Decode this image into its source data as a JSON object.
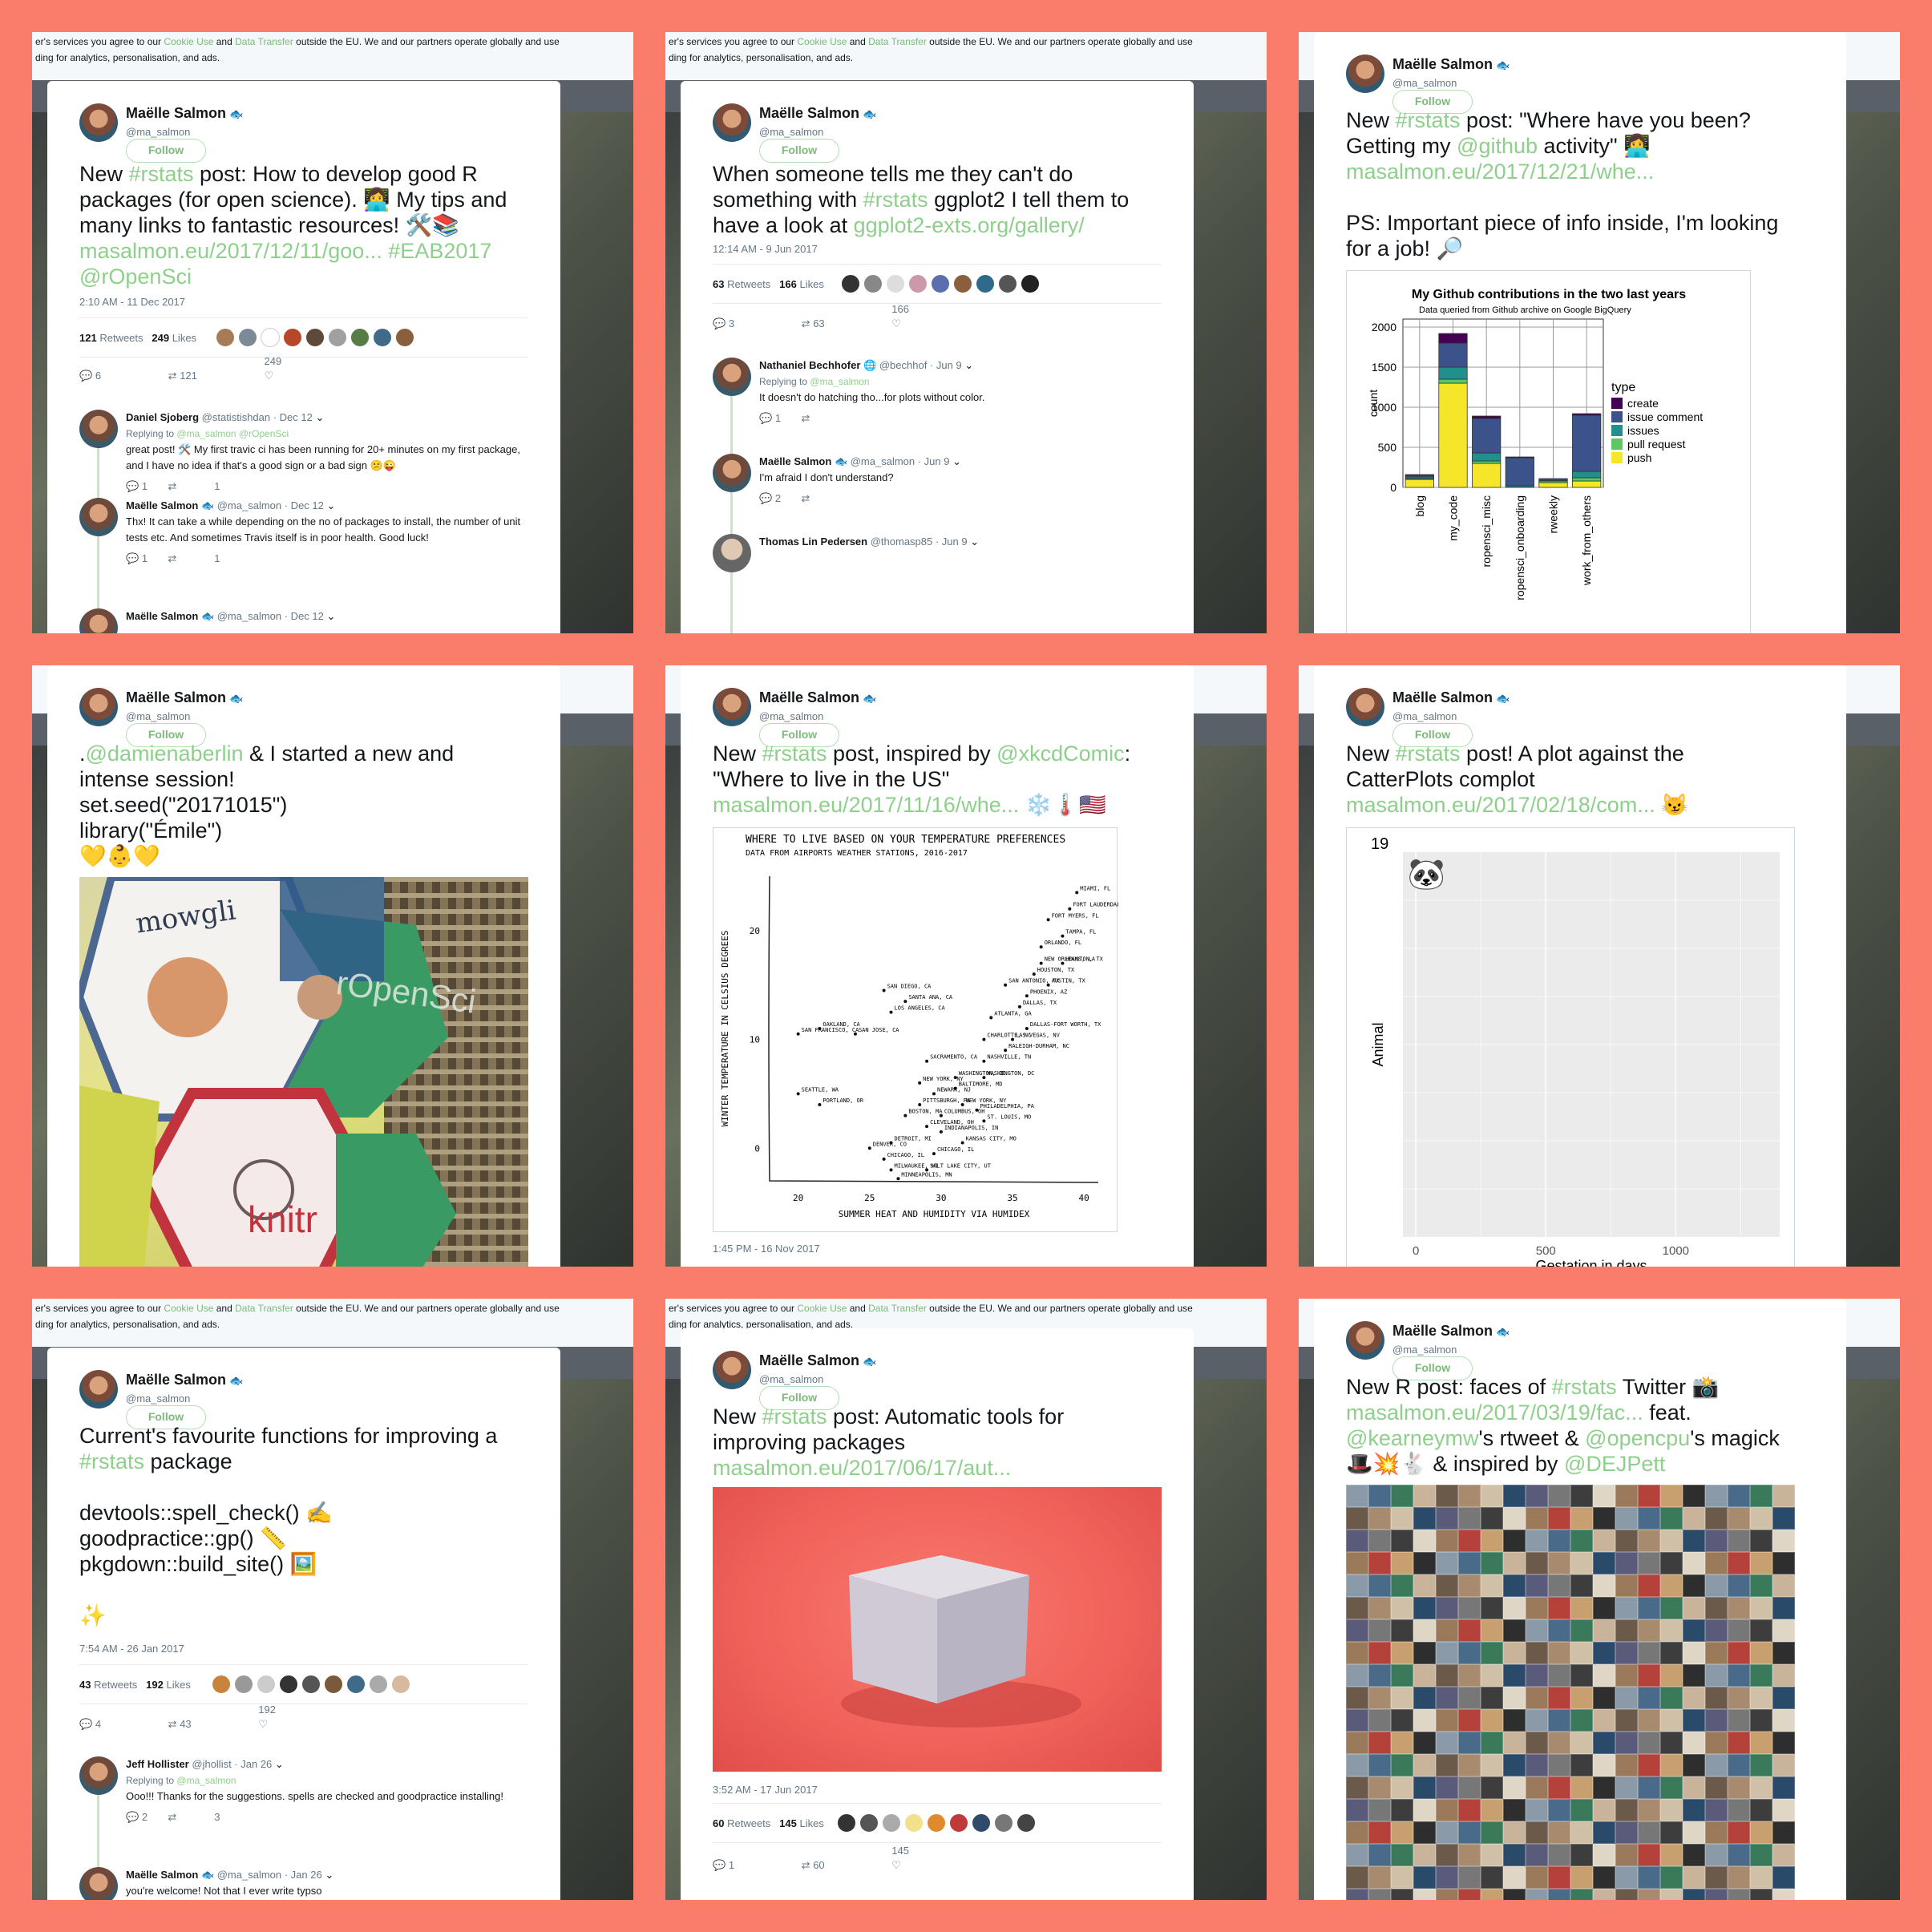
{
  "cookie": {
    "line1_a": "er's services you agree to our",
    "link1": "Cookie Use",
    "and": "and",
    "link2": "Data Transfer",
    "line1_b": "outside the EU. We and our partners operate globally and use",
    "line2": "ding for analytics, personalisation, and ads."
  },
  "author": {
    "name": "Maëlle Salmon",
    "handle": "@ma_salmon",
    "follow": "Follow",
    "fish": "🐟"
  },
  "t1": {
    "text_a": "New ",
    "tag": "#rstats",
    "text_b": " post: How to develop good R\npackages (for open science). 👩‍💻 My tips and\nmany links to fantastic resources! 🛠️📚\n",
    "link": "masalmon.eu/2017/12/11/goo...",
    "text_c": " ",
    "tag2": "#EAB2017",
    "text_d": "\n",
    "mention": "@rOpenSci",
    "time": "2:10 AM - 11 Dec 2017",
    "retweets": "121",
    "retweets_label": "Retweets",
    "likes": "249",
    "likes_label": "Likes",
    "act_replies": "6",
    "act_rt": "121",
    "act_likes": "249",
    "replies": [
      {
        "name": "Daniel Sjoberg",
        "handle": "@statistishdan · Dec 12",
        "replying": "Replying to",
        "rto": "@ma_salmon @rOpenSci",
        "body": "great post! 🛠️ My first travic ci has been running for 20+ minutes on my first package, and I have no idea if that's a good sign or a bad sign 😕😜",
        "acts": [
          "1",
          "",
          "1"
        ]
      },
      {
        "name": "Maëlle Salmon",
        "handle": "🐟 @ma_salmon · Dec 12",
        "body": "Thx! It can take a while depending on the no of packages to install, the number of unit tests etc. And sometimes Travis itself is in poor health. Good luck!",
        "acts": [
          "1",
          "",
          "1"
        ]
      },
      {
        "name": "Maëlle Salmon",
        "handle": "🐟 @ma_salmon · Dec 12",
        "body": ""
      }
    ]
  },
  "t2": {
    "text_a": "When someone tells me they can't do\nsomething with ",
    "tag": "#rstats",
    "text_b": " ggplot2 I tell them to\nhave a look at ",
    "link": "ggplot2-exts.org/gallery/",
    "time": "12:14 AM - 9 Jun 2017",
    "retweets": "63",
    "retweets_label": "Retweets",
    "likes": "166",
    "likes_label": "Likes",
    "act_replies": "3",
    "act_rt": "63",
    "act_likes": "166",
    "replies": [
      {
        "name": "Nathaniel Bechhofer",
        "handle": "🌐 @bechhof · Jun 9",
        "replying": "Replying to",
        "rto": "@ma_salmon",
        "body": "It doesn't do hatching tho...for plots without color.",
        "acts": [
          "1",
          "",
          ""
        ]
      },
      {
        "name": "Maëlle Salmon",
        "handle": "🐟 @ma_salmon · Jun 9",
        "body": "I'm afraid I don't understand?",
        "acts": [
          "2",
          "",
          ""
        ]
      },
      {
        "name": "Thomas Lin Pedersen",
        "handle": "@thomasp85 · Jun 9",
        "body": ""
      }
    ]
  },
  "t3": {
    "text_a": "New ",
    "tag": "#rstats",
    "text_b": " post: \"Where have you been?\nGetting my ",
    "mention": "@github",
    "text_c": " activity\" 👩‍💻\n",
    "link": "masalmon.eu/2017/12/21/whe...",
    "text_d": "\n\nPS: Important piece of info inside, I'm looking\nfor a job! 🔎"
  },
  "chart_data": [
    {
      "type": "bar",
      "title": "My Github contributions in the two last years",
      "subtitle": "Data queried from Github archive on Google BigQuery",
      "xlabel": "",
      "ylabel": "count",
      "categories": [
        "blog",
        "my_code",
        "ropensci_misc",
        "ropensci_onboarding",
        "rweekly",
        "work_from_others"
      ],
      "ylim": [
        0,
        2100
      ],
      "yticks": [
        0,
        500,
        1000,
        1500,
        2000
      ],
      "legend_title": "type",
      "series": [
        {
          "name": "push",
          "color": "#f5e62a",
          "values": [
            100,
            1300,
            300,
            0,
            60,
            80
          ]
        },
        {
          "name": "pull request",
          "color": "#5cc863",
          "values": [
            10,
            50,
            30,
            0,
            20,
            40
          ]
        },
        {
          "name": "issues",
          "color": "#21908d",
          "values": [
            20,
            150,
            100,
            20,
            10,
            80
          ]
        },
        {
          "name": "issue comment",
          "color": "#3b528b",
          "values": [
            20,
            300,
            430,
            350,
            20,
            700
          ]
        },
        {
          "name": "create",
          "color": "#440154",
          "values": [
            10,
            120,
            30,
            10,
            0,
            20
          ]
        }
      ],
      "legend_position": "right",
      "grid": true
    },
    {
      "type": "scatter",
      "title": "WHERE TO LIVE BASED ON YOUR TEMPERATURE PREFERENCES",
      "subtitle": "DATA FROM AIRPORTS WEATHER STATIONS, 2016-2017",
      "xlabel": "SUMMER HEAT AND HUMIDITY VIA HUMIDEX",
      "ylabel": "WINTER TEMPERATURE IN CELSIUS DEGREES",
      "xlim": [
        18,
        41
      ],
      "ylim": [
        -3,
        25
      ],
      "xticks": [
        20,
        25,
        30,
        35,
        40
      ],
      "yticks": [
        0,
        10,
        20
      ],
      "points": [
        {
          "label": "MIAMI, FL",
          "x": 39.5,
          "y": 23.5
        },
        {
          "label": "FORT LAUDERDALE, FL",
          "x": 39,
          "y": 22
        },
        {
          "label": "FORT MYERS, FL",
          "x": 37.5,
          "y": 21
        },
        {
          "label": "TAMPA, FL",
          "x": 38.5,
          "y": 19.5
        },
        {
          "label": "ORLANDO, FL",
          "x": 37,
          "y": 18.5
        },
        {
          "label": "NEW ORLEANS, LA",
          "x": 37,
          "y": 17
        },
        {
          "label": "HOUSTON, TX",
          "x": 38.5,
          "y": 17
        },
        {
          "label": "HOUSTON, TX",
          "x": 36.5,
          "y": 16
        },
        {
          "label": "SAN ANTONIO, TX",
          "x": 34.5,
          "y": 15
        },
        {
          "label": "AUSTIN, TX",
          "x": 37.5,
          "y": 15
        },
        {
          "label": "PHOENIX, AZ",
          "x": 36,
          "y": 14
        },
        {
          "label": "DALLAS, TX",
          "x": 35.5,
          "y": 13
        },
        {
          "label": "ATLANTA, GA",
          "x": 33.5,
          "y": 12
        },
        {
          "label": "DALLAS-FORT WORTH, TX",
          "x": 36,
          "y": 11
        },
        {
          "label": "CHARLOTTE, NC",
          "x": 33,
          "y": 10
        },
        {
          "label": "LAS VEGAS, NV",
          "x": 35,
          "y": 10
        },
        {
          "label": "RALEIGH-DURHAM, NC",
          "x": 34.5,
          "y": 9
        },
        {
          "label": "NASHVILLE, TN",
          "x": 33,
          "y": 8
        },
        {
          "label": "WASHINGTON, DC",
          "x": 33,
          "y": 6.5
        },
        {
          "label": "WASHINGTON, DC",
          "x": 31,
          "y": 6.5
        },
        {
          "label": "BALTIMORE, MD",
          "x": 31,
          "y": 5.5
        },
        {
          "label": "SAN DIEGO, CA",
          "x": 26,
          "y": 14.5
        },
        {
          "label": "SANTA ANA, CA",
          "x": 27.5,
          "y": 13.5
        },
        {
          "label": "LOS ANGELES, CA",
          "x": 26.5,
          "y": 12.5
        },
        {
          "label": "OAKLAND, CA",
          "x": 21.5,
          "y": 11
        },
        {
          "label": "SAN FRANCISCO, CA",
          "x": 20,
          "y": 10.5
        },
        {
          "label": "SAN JOSE, CA",
          "x": 24,
          "y": 10.5
        },
        {
          "label": "SACRAMENTO, CA",
          "x": 29,
          "y": 8
        },
        {
          "label": "NEW YORK, NY",
          "x": 28.5,
          "y": 6
        },
        {
          "label": "NEWARK, NJ",
          "x": 29.5,
          "y": 5
        },
        {
          "label": "PITTSBURGH, PA",
          "x": 28.5,
          "y": 4
        },
        {
          "label": "NEW YORK, NY",
          "x": 31.5,
          "y": 4
        },
        {
          "label": "PHILADELPHIA, PA",
          "x": 32.5,
          "y": 3.5
        },
        {
          "label": "BOSTON, MA",
          "x": 27.5,
          "y": 3
        },
        {
          "label": "COLUMBUS, OH",
          "x": 30,
          "y": 3
        },
        {
          "label": "ST. LOUIS, MO",
          "x": 33,
          "y": 2.5
        },
        {
          "label": "CLEVELAND, OH",
          "x": 29,
          "y": 2
        },
        {
          "label": "INDIANAPOLIS, IN",
          "x": 30,
          "y": 1.5
        },
        {
          "label": "SEATTLE, WA",
          "x": 20,
          "y": 5
        },
        {
          "label": "PORTLAND, OR",
          "x": 21.5,
          "y": 4
        },
        {
          "label": "DETROIT, MI",
          "x": 26.5,
          "y": 0.5
        },
        {
          "label": "DENVER, CO",
          "x": 25,
          "y": 0
        },
        {
          "label": "CHICAGO, IL",
          "x": 26,
          "y": -1
        },
        {
          "label": "CHICAGO, IL",
          "x": 29.5,
          "y": -0.5
        },
        {
          "label": "KANSAS CITY, MO",
          "x": 31.5,
          "y": 0.5
        },
        {
          "label": "MILWAUKEE, WI",
          "x": 26.5,
          "y": -2
        },
        {
          "label": "SALT LAKE CITY, UT",
          "x": 29,
          "y": -2
        },
        {
          "label": "MINNEAPOLIS, MN",
          "x": 27,
          "y": -7
        }
      ]
    },
    {
      "type": "scatter",
      "title": "19",
      "xlabel": "Gestation in days",
      "ylabel": "Animal",
      "xlim": [
        -50,
        1400
      ],
      "xticks": [
        0,
        500,
        1000
      ],
      "points": [
        {
          "x": 40,
          "label": "🐼"
        }
      ],
      "grid": true
    }
  ],
  "t4": {
    "text_a": ".",
    "mention": "@damienaberlin",
    "text_b": " & I started a new and\nintense session!\nset.seed(\"20171015\")\nlibrary(\"Émile\")\n💛👶💛",
    "img": {
      "mowgli": "mowgli",
      "ropensci": "rOpenSci",
      "knitr": "knitr"
    }
  },
  "t5": {
    "text_a": "New ",
    "tag": "#rstats",
    "text_b": " post, inspired by ",
    "mention": "@xkcdComic",
    "text_c": ":\n\"Where to live in the US\"\n",
    "link": "masalmon.eu/2017/11/16/whe...",
    "text_d": " ❄️🌡️🇺🇸",
    "time": "1:45 PM - 16 Nov 2017"
  },
  "t6": {
    "text_a": "New ",
    "tag": "#rstats",
    "text_b": " post! A plot against the\nCatterPlots complot\n",
    "link": "masalmon.eu/2017/02/18/com...",
    "text_c": " 😼"
  },
  "t7": {
    "text_a": "Current's favourite functions for improving a\n",
    "tag": "#rstats",
    "text_b": " package\n\ndevtools::spell_check() ✍️\ngoodpractice::gp() 📏\npkgdown::build_site() 🖼️\n\n✨",
    "time": "7:54 AM - 26 Jan 2017",
    "retweets": "43",
    "retweets_label": "Retweets",
    "likes": "192",
    "likes_label": "Likes",
    "act_replies": "4",
    "act_rt": "43",
    "act_likes": "192",
    "replies": [
      {
        "name": "Jeff Hollister",
        "handle": "@jhollist · Jan 26",
        "replying": "Replying to",
        "rto": "@ma_salmon",
        "body": "Ooo!!! Thanks for the suggestions. spells are checked and goodpractice installing!",
        "acts": [
          "2",
          "",
          "3"
        ]
      },
      {
        "name": "Maëlle Salmon",
        "handle": "🐟 @ma_salmon · Jan 26",
        "body": "you're welcome! Not that I ever write typso"
      }
    ]
  },
  "t8": {
    "text_a": "New ",
    "tag": "#rstats",
    "text_b": " post: Automatic tools for\nimproving packages\n",
    "link": "masalmon.eu/2017/06/17/aut...",
    "time": "3:52 AM - 17 Jun 2017",
    "retweets": "60",
    "retweets_label": "Retweets",
    "likes": "145",
    "likes_label": "Likes",
    "act_replies": "1",
    "act_rt": "60",
    "act_likes": "145"
  },
  "t9": {
    "text_a": "New R post: faces of ",
    "tag": "#rstats",
    "text_b": " Twitter 📸\n",
    "link": "masalmon.eu/2017/03/19/fac...",
    "text_c": " feat.\n",
    "mention1": "@kearneymw",
    "text_d": "'s rtweet & ",
    "mention2": "@opencpu",
    "text_e": "'s magick\n🎩💥🐇 & inspired by ",
    "mention3": "@DEJPett"
  },
  "icons": {
    "reply": "reply-icon",
    "retweet": "retweet-icon",
    "like": "heart-icon",
    "chevron": "chevron-down-icon"
  }
}
